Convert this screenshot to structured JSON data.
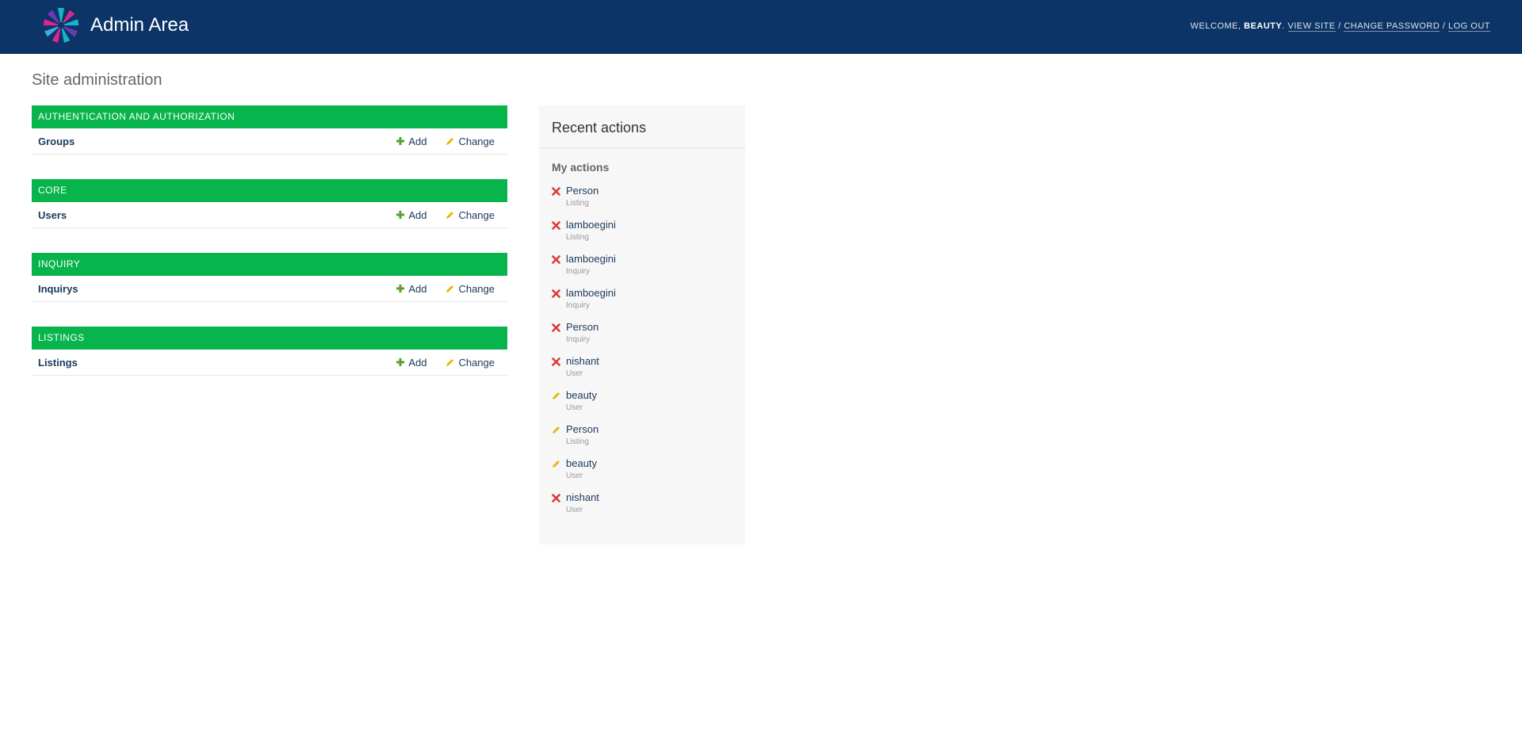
{
  "header": {
    "brand_title": "Admin Area",
    "welcome_prefix": "WELCOME,",
    "username": "BEAUTY",
    "username_suffix": ".",
    "view_site": "VIEW SITE",
    "separator": "/",
    "change_password": "CHANGE PASSWORD",
    "log_out": "LOG OUT"
  },
  "page_title": "Site administration",
  "modules": [
    {
      "caption": "AUTHENTICATION AND AUTHORIZATION",
      "model": "Groups",
      "add_label": "Add",
      "change_label": "Change"
    },
    {
      "caption": "CORE",
      "model": "Users",
      "add_label": "Add",
      "change_label": "Change"
    },
    {
      "caption": "INQUIRY",
      "model": "Inquirys",
      "add_label": "Add",
      "change_label": "Change"
    },
    {
      "caption": "LISTINGS",
      "model": "Listings",
      "add_label": "Add",
      "change_label": "Change"
    }
  ],
  "recent_actions": {
    "title": "Recent actions",
    "subtitle": "My actions",
    "items": [
      {
        "name": "Person",
        "type": "Listing",
        "icon": "delete-icon"
      },
      {
        "name": "lamboegini",
        "type": "Listing",
        "icon": "delete-icon"
      },
      {
        "name": "lamboegini",
        "type": "Inquiry",
        "icon": "delete-icon"
      },
      {
        "name": "lamboegini",
        "type": "Inquiry",
        "icon": "delete-icon"
      },
      {
        "name": "Person",
        "type": "Inquiry",
        "icon": "delete-icon"
      },
      {
        "name": "nishant",
        "type": "User",
        "icon": "delete-icon"
      },
      {
        "name": "beauty",
        "type": "User",
        "icon": "change-icon"
      },
      {
        "name": "Person",
        "type": "Listing",
        "icon": "change-icon"
      },
      {
        "name": "beauty",
        "type": "User",
        "icon": "change-icon"
      },
      {
        "name": "nishant",
        "type": "User",
        "icon": "delete-icon"
      }
    ]
  },
  "colors": {
    "header_bg": "#0c3467",
    "module_caption_bg": "#08b44c",
    "add_icon": "#5aa02c",
    "change_icon": "#e8b500",
    "delete_icon": "#d93a3a"
  }
}
